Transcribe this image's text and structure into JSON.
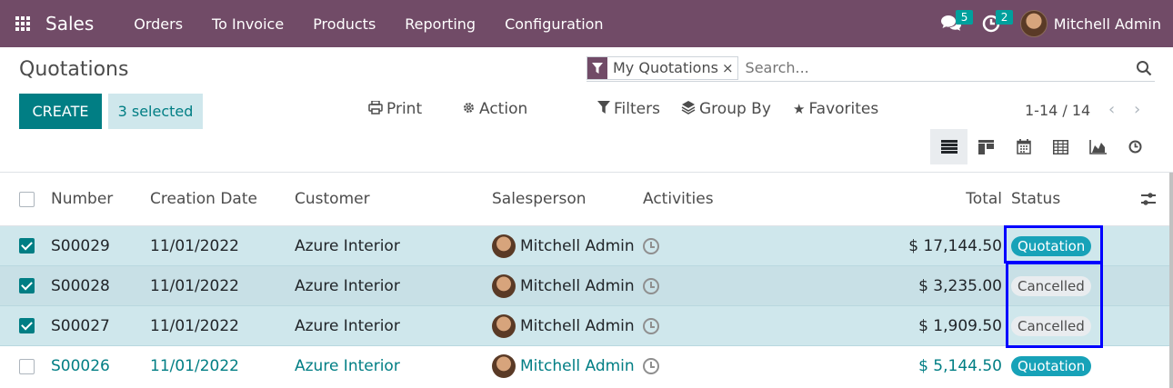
{
  "navbar": {
    "app_name": "Sales",
    "menu": [
      "Orders",
      "To Invoice",
      "Products",
      "Reporting",
      "Configuration"
    ],
    "messages_count": "5",
    "activities_count": "2",
    "user_name": "Mitchell Admin",
    "bg_color": "#714b67"
  },
  "control": {
    "title": "Quotations",
    "facet_label": "My Quotations",
    "facet_close": "×",
    "search_placeholder": "Search...",
    "create_label": "CREATE",
    "selected_label": "3 selected",
    "print_label": "Print",
    "action_label": "Action",
    "filters_label": "Filters",
    "group_by_label": "Group By",
    "favorites_label": "Favorites",
    "pager": "1-14 / 14",
    "views": [
      "list-icon",
      "kanban-icon",
      "calendar-icon",
      "pivot-icon",
      "graph-icon",
      "activity-icon"
    ]
  },
  "table": {
    "headers": {
      "number": "Number",
      "date": "Creation Date",
      "customer": "Customer",
      "salesperson": "Salesperson",
      "activities": "Activities",
      "total": "Total",
      "status": "Status"
    },
    "rows": [
      {
        "number": "S00029",
        "date": "11/01/2022",
        "customer": "Azure Interior",
        "salesperson": "Mitchell Admin",
        "total": "$ 17,144.50",
        "status": "Quotation",
        "selected": true
      },
      {
        "number": "S00028",
        "date": "11/01/2022",
        "customer": "Azure Interior",
        "salesperson": "Mitchell Admin",
        "total": "$ 3,235.00",
        "status": "Cancelled",
        "selected": true
      },
      {
        "number": "S00027",
        "date": "11/01/2022",
        "customer": "Azure Interior",
        "salesperson": "Mitchell Admin",
        "total": "$ 1,909.50",
        "status": "Cancelled",
        "selected": true
      },
      {
        "number": "S00026",
        "date": "11/01/2022",
        "customer": "Azure Interior",
        "salesperson": "Mitchell Admin",
        "total": "$ 5,144.50",
        "status": "Quotation",
        "selected": false
      }
    ]
  },
  "colors": {
    "accent": "#017e84",
    "selected_row": "#cfe7ec",
    "quotation_badge": "#17a2b8",
    "highlight": "#0000ff"
  }
}
